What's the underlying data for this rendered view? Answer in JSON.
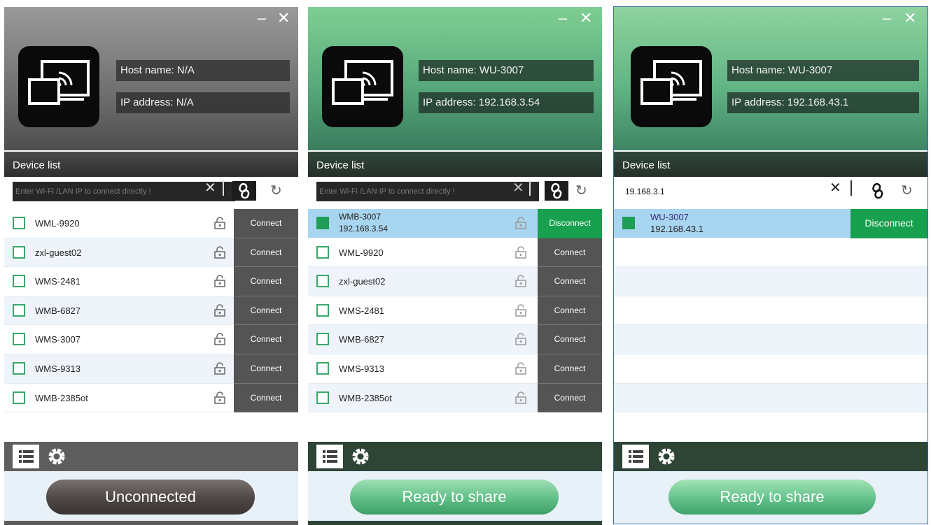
{
  "panels": [
    {
      "host": "Host name: N/A",
      "ip": "IP address: N/A",
      "device_list_label": "Device list",
      "search_value": "",
      "search_placeholder": "Enter Wi-Fi /LAN IP to connect directly !",
      "status": "Unconnected",
      "devices": [
        {
          "name": "WML-9920",
          "action": "Connect"
        },
        {
          "name": "zxl-guest02",
          "action": "Connect"
        },
        {
          "name": "WMS-2481",
          "action": "Connect"
        },
        {
          "name": "WMB-6827",
          "action": "Connect"
        },
        {
          "name": "WMS-3007",
          "action": "Connect"
        },
        {
          "name": "WMS-9313",
          "action": "Connect"
        },
        {
          "name": "WMB-2385ot",
          "action": "Connect"
        }
      ]
    },
    {
      "host": "Host name: WU-3007",
      "ip": "IP address: 192.168.3.54",
      "device_list_label": "Device list",
      "search_value": "",
      "search_placeholder": "Enter Wi-Fi /LAN IP to connect directly !",
      "status": "Ready to share",
      "devices": [
        {
          "name": "WMB-3007",
          "ip": "192.168.3.54",
          "action": "Disconnect",
          "connected": true
        },
        {
          "name": "WML-9920",
          "action": "Connect"
        },
        {
          "name": "zxl-guest02",
          "action": "Connect"
        },
        {
          "name": "WMS-2481",
          "action": "Connect"
        },
        {
          "name": "WMB-6827",
          "action": "Connect"
        },
        {
          "name": "WMS-9313",
          "action": "Connect"
        },
        {
          "name": "WMB-2385ot",
          "action": "Connect"
        }
      ]
    },
    {
      "host": "Host name: WU-3007",
      "ip": "IP address: 192.168.43.1",
      "device_list_label": "Device list",
      "search_value": "19.168.3.1",
      "status": "Ready to share",
      "devices": [
        {
          "name": "WU-3007",
          "ip": "192.168.43.1",
          "action": "Disconnect",
          "connected": true
        }
      ]
    }
  ],
  "icons": {
    "minimize": "–",
    "close": "✕",
    "clear": "✕",
    "link": "🔗",
    "refresh": "↻"
  },
  "colors": {
    "connect_button": "#545454",
    "disconnect_button": "#17a04e",
    "selected_row": "#a8d5ef",
    "checkbox": "#3aa86a"
  }
}
